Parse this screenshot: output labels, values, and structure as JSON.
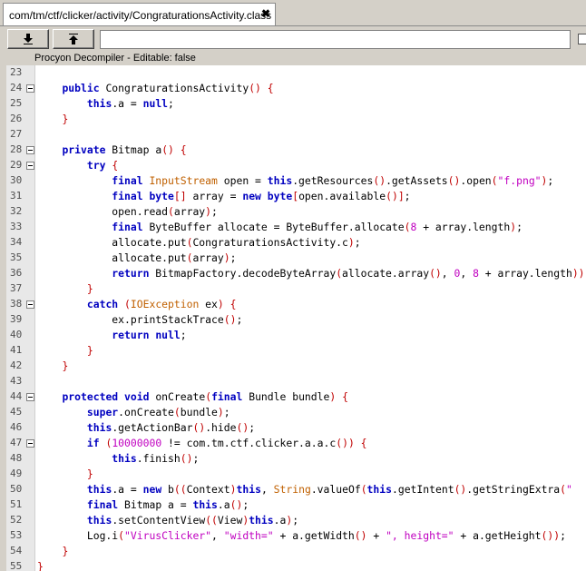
{
  "tab": {
    "title": "com/tm/ctf/clicker/activity/CongraturationsActivity.class",
    "close_label": "✖"
  },
  "toolbar": {
    "download_icon": "arrow-down-to-line-icon",
    "upload_icon": "arrow-up-to-line-icon",
    "search_value": ""
  },
  "status": {
    "text": "Procyon Decompiler - Editable: false"
  },
  "colors": {
    "keyword": "#0000c0",
    "type": "#c06000",
    "string": "#c000c0",
    "bracket": "#c00000"
  },
  "lines": [
    {
      "n": "23",
      "fold": false,
      "tokens": []
    },
    {
      "n": "24",
      "fold": true,
      "tokens": [
        [
          "    ",
          ""
        ],
        [
          "public",
          "kw"
        ],
        [
          " CongraturationsActivity",
          ""
        ],
        [
          "()",
          "br"
        ],
        [
          " ",
          ""
        ],
        [
          "{",
          "br"
        ]
      ]
    },
    {
      "n": "25",
      "fold": false,
      "tokens": [
        [
          "        ",
          ""
        ],
        [
          "this",
          "kw"
        ],
        [
          ".a = ",
          ""
        ],
        [
          "null",
          "kw"
        ],
        [
          ";",
          ""
        ]
      ]
    },
    {
      "n": "26",
      "fold": false,
      "tokens": [
        [
          "    ",
          ""
        ],
        [
          "}",
          "br"
        ]
      ]
    },
    {
      "n": "27",
      "fold": false,
      "tokens": []
    },
    {
      "n": "28",
      "fold": true,
      "tokens": [
        [
          "    ",
          ""
        ],
        [
          "private",
          "kw"
        ],
        [
          " Bitmap a",
          ""
        ],
        [
          "()",
          "br"
        ],
        [
          " ",
          ""
        ],
        [
          "{",
          "br"
        ]
      ]
    },
    {
      "n": "29",
      "fold": true,
      "tokens": [
        [
          "        ",
          ""
        ],
        [
          "try",
          "kw"
        ],
        [
          " ",
          ""
        ],
        [
          "{",
          "br"
        ]
      ]
    },
    {
      "n": "30",
      "fold": false,
      "tokens": [
        [
          "            ",
          ""
        ],
        [
          "final",
          "kw"
        ],
        [
          " ",
          ""
        ],
        [
          "InputStream",
          "ty"
        ],
        [
          " open = ",
          ""
        ],
        [
          "this",
          "kw"
        ],
        [
          ".getResources",
          ""
        ],
        [
          "()",
          "br"
        ],
        [
          ".getAssets",
          ""
        ],
        [
          "()",
          "br"
        ],
        [
          ".open",
          ""
        ],
        [
          "(",
          "br"
        ],
        [
          "\"f.png\"",
          "str"
        ],
        [
          ")",
          "br"
        ],
        [
          ";",
          ""
        ]
      ]
    },
    {
      "n": "31",
      "fold": false,
      "tokens": [
        [
          "            ",
          ""
        ],
        [
          "final",
          "kw"
        ],
        [
          " ",
          ""
        ],
        [
          "byte",
          "kw"
        ],
        [
          "[]",
          "br"
        ],
        [
          " array = ",
          ""
        ],
        [
          "new",
          "kw"
        ],
        [
          " ",
          ""
        ],
        [
          "byte",
          "kw"
        ],
        [
          "[",
          "br"
        ],
        [
          "open.available",
          ""
        ],
        [
          "()",
          "br"
        ],
        [
          "]",
          "br"
        ],
        [
          ";",
          ""
        ]
      ]
    },
    {
      "n": "32",
      "fold": false,
      "tokens": [
        [
          "            open.read",
          ""
        ],
        [
          "(",
          "br"
        ],
        [
          "array",
          ""
        ],
        [
          ")",
          "br"
        ],
        [
          ";",
          ""
        ]
      ]
    },
    {
      "n": "33",
      "fold": false,
      "tokens": [
        [
          "            ",
          ""
        ],
        [
          "final",
          "kw"
        ],
        [
          " ByteBuffer allocate = ByteBuffer.allocate",
          ""
        ],
        [
          "(",
          "br"
        ],
        [
          "8",
          "num"
        ],
        [
          " + array.length",
          ""
        ],
        [
          ")",
          "br"
        ],
        [
          ";",
          ""
        ]
      ]
    },
    {
      "n": "34",
      "fold": false,
      "tokens": [
        [
          "            allocate.put",
          ""
        ],
        [
          "(",
          "br"
        ],
        [
          "CongraturationsActivity.c",
          ""
        ],
        [
          ")",
          "br"
        ],
        [
          ";",
          ""
        ]
      ]
    },
    {
      "n": "35",
      "fold": false,
      "tokens": [
        [
          "            allocate.put",
          ""
        ],
        [
          "(",
          "br"
        ],
        [
          "array",
          ""
        ],
        [
          ")",
          "br"
        ],
        [
          ";",
          ""
        ]
      ]
    },
    {
      "n": "36",
      "fold": false,
      "tokens": [
        [
          "            ",
          ""
        ],
        [
          "return",
          "kw"
        ],
        [
          " BitmapFactory.decodeByteArray",
          ""
        ],
        [
          "(",
          "br"
        ],
        [
          "allocate.array",
          ""
        ],
        [
          "()",
          "br"
        ],
        [
          ", ",
          ""
        ],
        [
          "0",
          "num"
        ],
        [
          ", ",
          ""
        ],
        [
          "8",
          "num"
        ],
        [
          " + array.length",
          ""
        ],
        [
          ")",
          "br"
        ],
        [
          ")",
          "br"
        ]
      ]
    },
    {
      "n": "37",
      "fold": false,
      "tokens": [
        [
          "        ",
          ""
        ],
        [
          "}",
          "br"
        ]
      ]
    },
    {
      "n": "38",
      "fold": true,
      "tokens": [
        [
          "        ",
          ""
        ],
        [
          "catch",
          "kw"
        ],
        [
          " ",
          ""
        ],
        [
          "(",
          "br"
        ],
        [
          "IOException",
          "ty"
        ],
        [
          " ex",
          ""
        ],
        [
          ")",
          "br"
        ],
        [
          " ",
          ""
        ],
        [
          "{",
          "br"
        ]
      ]
    },
    {
      "n": "39",
      "fold": false,
      "tokens": [
        [
          "            ex.printStackTrace",
          ""
        ],
        [
          "()",
          "br"
        ],
        [
          ";",
          ""
        ]
      ]
    },
    {
      "n": "40",
      "fold": false,
      "tokens": [
        [
          "            ",
          ""
        ],
        [
          "return",
          "kw"
        ],
        [
          " ",
          ""
        ],
        [
          "null",
          "kw"
        ],
        [
          ";",
          ""
        ]
      ]
    },
    {
      "n": "41",
      "fold": false,
      "tokens": [
        [
          "        ",
          ""
        ],
        [
          "}",
          "br"
        ]
      ]
    },
    {
      "n": "42",
      "fold": false,
      "tokens": [
        [
          "    ",
          ""
        ],
        [
          "}",
          "br"
        ]
      ]
    },
    {
      "n": "43",
      "fold": false,
      "tokens": []
    },
    {
      "n": "44",
      "fold": true,
      "tokens": [
        [
          "    ",
          ""
        ],
        [
          "protected",
          "kw"
        ],
        [
          " ",
          ""
        ],
        [
          "void",
          "kw"
        ],
        [
          " onCreate",
          ""
        ],
        [
          "(",
          "br"
        ],
        [
          "final",
          "kw"
        ],
        [
          " Bundle bundle",
          ""
        ],
        [
          ")",
          "br"
        ],
        [
          " ",
          ""
        ],
        [
          "{",
          "br"
        ]
      ]
    },
    {
      "n": "45",
      "fold": false,
      "tokens": [
        [
          "        ",
          ""
        ],
        [
          "super",
          "kw"
        ],
        [
          ".onCreate",
          ""
        ],
        [
          "(",
          "br"
        ],
        [
          "bundle",
          ""
        ],
        [
          ")",
          "br"
        ],
        [
          ";",
          ""
        ]
      ]
    },
    {
      "n": "46",
      "fold": false,
      "tokens": [
        [
          "        ",
          ""
        ],
        [
          "this",
          "kw"
        ],
        [
          ".getActionBar",
          ""
        ],
        [
          "()",
          "br"
        ],
        [
          ".hide",
          ""
        ],
        [
          "()",
          "br"
        ],
        [
          ";",
          ""
        ]
      ]
    },
    {
      "n": "47",
      "fold": true,
      "tokens": [
        [
          "        ",
          ""
        ],
        [
          "if",
          "kw"
        ],
        [
          " ",
          ""
        ],
        [
          "(",
          "br"
        ],
        [
          "10000000",
          "num"
        ],
        [
          " != com.tm.ctf.clicker.a.a.c",
          ""
        ],
        [
          "()",
          "br"
        ],
        [
          ")",
          "br"
        ],
        [
          " ",
          ""
        ],
        [
          "{",
          "br"
        ]
      ]
    },
    {
      "n": "48",
      "fold": false,
      "tokens": [
        [
          "            ",
          ""
        ],
        [
          "this",
          "kw"
        ],
        [
          ".finish",
          ""
        ],
        [
          "()",
          "br"
        ],
        [
          ";",
          ""
        ]
      ]
    },
    {
      "n": "49",
      "fold": false,
      "tokens": [
        [
          "        ",
          ""
        ],
        [
          "}",
          "br"
        ]
      ]
    },
    {
      "n": "50",
      "fold": false,
      "tokens": [
        [
          "        ",
          ""
        ],
        [
          "this",
          "kw"
        ],
        [
          ".a = ",
          ""
        ],
        [
          "new",
          "kw"
        ],
        [
          " b",
          ""
        ],
        [
          "((",
          "br"
        ],
        [
          "Context",
          ""
        ],
        [
          ")",
          "br"
        ],
        [
          "this",
          "kw"
        ],
        [
          ", ",
          ""
        ],
        [
          "String",
          "ty"
        ],
        [
          ".valueOf",
          ""
        ],
        [
          "(",
          "br"
        ],
        [
          "this",
          "kw"
        ],
        [
          ".getIntent",
          ""
        ],
        [
          "()",
          "br"
        ],
        [
          ".getStringExtra",
          ""
        ],
        [
          "(",
          "br"
        ],
        [
          "\"",
          "str"
        ]
      ]
    },
    {
      "n": "51",
      "fold": false,
      "tokens": [
        [
          "        ",
          ""
        ],
        [
          "final",
          "kw"
        ],
        [
          " Bitmap a = ",
          ""
        ],
        [
          "this",
          "kw"
        ],
        [
          ".a",
          ""
        ],
        [
          "()",
          "br"
        ],
        [
          ";",
          ""
        ]
      ]
    },
    {
      "n": "52",
      "fold": false,
      "tokens": [
        [
          "        ",
          ""
        ],
        [
          "this",
          "kw"
        ],
        [
          ".setContentView",
          ""
        ],
        [
          "((",
          "br"
        ],
        [
          "View",
          ""
        ],
        [
          ")",
          "br"
        ],
        [
          "this",
          "kw"
        ],
        [
          ".a",
          ""
        ],
        [
          ")",
          "br"
        ],
        [
          ";",
          ""
        ]
      ]
    },
    {
      "n": "53",
      "fold": false,
      "tokens": [
        [
          "        Log.i",
          ""
        ],
        [
          "(",
          "br"
        ],
        [
          "\"VirusClicker\"",
          "str"
        ],
        [
          ", ",
          ""
        ],
        [
          "\"width=\"",
          "str"
        ],
        [
          " + a.getWidth",
          ""
        ],
        [
          "()",
          "br"
        ],
        [
          " + ",
          ""
        ],
        [
          "\", height=\"",
          "str"
        ],
        [
          " + a.getHeight",
          ""
        ],
        [
          "()",
          "br"
        ],
        [
          ")",
          "br"
        ],
        [
          ";",
          ""
        ]
      ]
    },
    {
      "n": "54",
      "fold": false,
      "tokens": [
        [
          "    ",
          ""
        ],
        [
          "}",
          "br"
        ]
      ]
    },
    {
      "n": "55",
      "fold": false,
      "tokens": [
        [
          "",
          ""
        ],
        [
          "}",
          "br"
        ]
      ]
    }
  ]
}
